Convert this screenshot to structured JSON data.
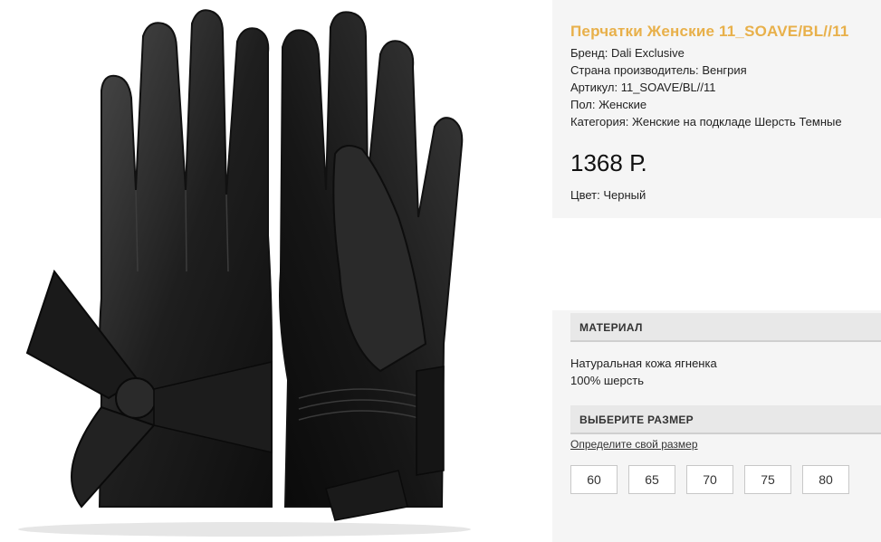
{
  "product": {
    "title": "Перчатки Женские 11_SOAVE/BL//11",
    "image_alt": "black-leather-gloves-with-bow-icon",
    "specs": [
      {
        "label": "Бренд:",
        "value": "Dali Exclusive"
      },
      {
        "label": "Страна производитель:",
        "value": "Венгрия"
      },
      {
        "label": "Артикул:",
        "value": "11_SOAVE/BL//11"
      },
      {
        "label": "Пол:",
        "value": "Женские"
      },
      {
        "label": "Категория:",
        "value": "Женские на подкладе Шерсть Темные"
      }
    ],
    "price": "1368 Р.",
    "color": {
      "label": "Цвет:",
      "value": "Черный"
    }
  },
  "material": {
    "header": "МАТЕРИАЛ",
    "lines": [
      "Натуральная кожа ягненка",
      "100% шерсть"
    ]
  },
  "sizes": {
    "header": "ВЫБЕРИТЕ РАЗМЕР",
    "help_link": "Определите свой размер",
    "options": [
      "60",
      "65",
      "70",
      "75",
      "80"
    ]
  },
  "colors": {
    "title_accent": "#e8b04a",
    "panel_bg": "#f5f5f5",
    "header_bg": "#e8e8e8"
  }
}
